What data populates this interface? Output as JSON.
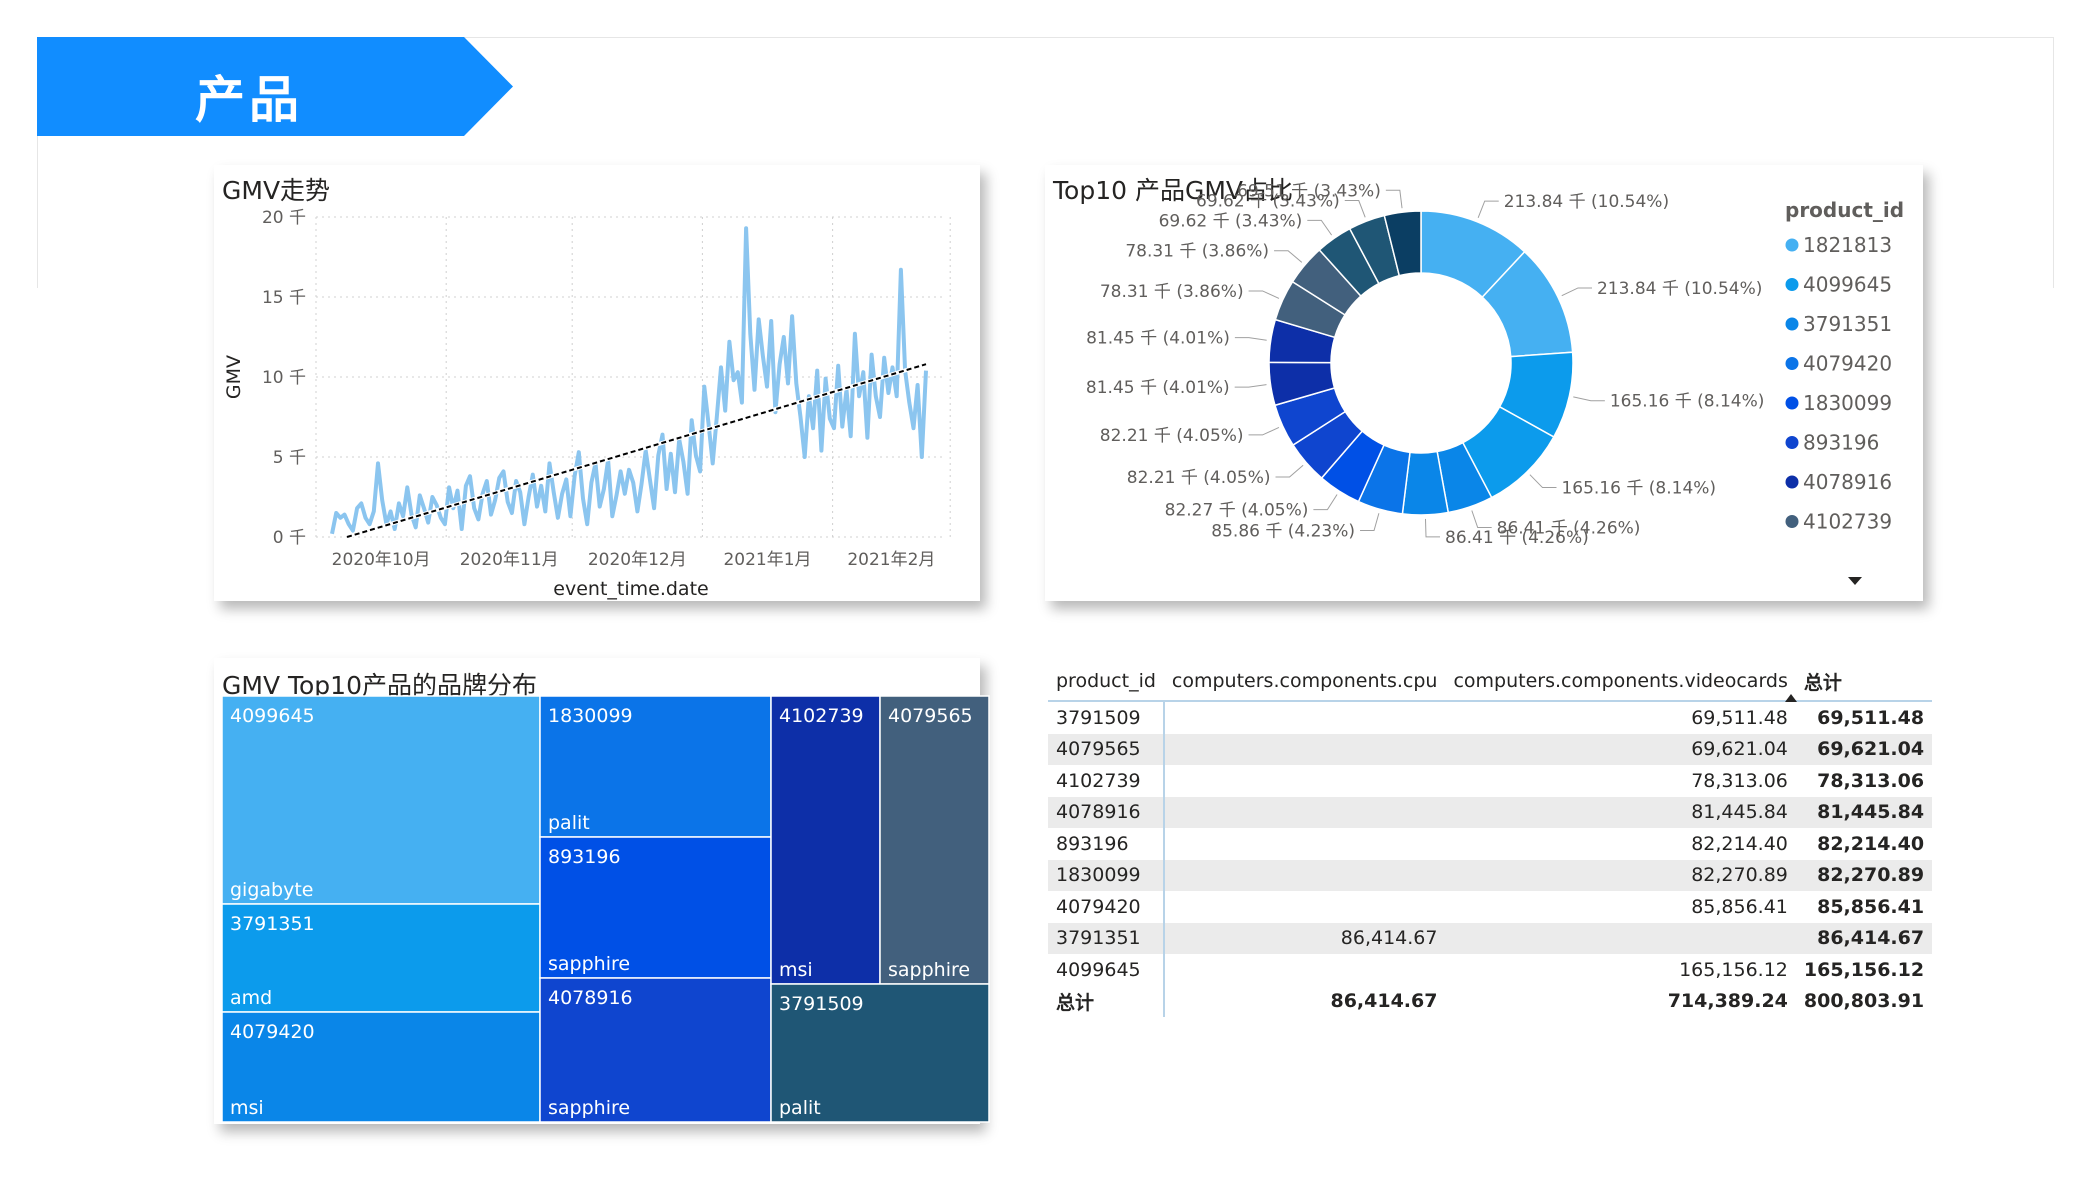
{
  "header": {
    "title": "产品",
    "color": "#118DFF"
  },
  "line_card": {
    "title": "GMV走势",
    "chart_data": {
      "type": "line",
      "title": "GMV走势",
      "xlabel": "event_time.date",
      "ylabel": "GMV",
      "y_ticks": [
        "0 千",
        "5 千",
        "10 千",
        "15 千",
        "20 千"
      ],
      "ylim": [
        0,
        20000
      ],
      "x_ticks": [
        "2020年10月",
        "2020年11月",
        "2020年12月",
        "2021年1月",
        "2021年2月"
      ],
      "x_range": [
        "2020-10-01",
        "2021-02-28"
      ],
      "series": [
        {
          "values": [
            200,
            1500,
            1200,
            1400,
            800,
            400,
            1800,
            2100,
            1200,
            800,
            1600,
            4600,
            2300,
            800,
            1600,
            500,
            2100,
            1300,
            3100,
            1400,
            600,
            2600,
            1800,
            900,
            2500,
            2000,
            1200,
            800,
            3100,
            1800,
            2900,
            500,
            3200,
            3800,
            1800,
            1100,
            2700,
            3500,
            1400,
            2300,
            3700,
            4100,
            2200,
            1500,
            3500,
            2800,
            800,
            2500,
            3900,
            1900,
            3200,
            1600,
            4600,
            2800,
            1200,
            2700,
            3600,
            1300,
            3800,
            5300,
            2400,
            800,
            3400,
            4600,
            1900,
            3000,
            4800,
            1300,
            2600,
            4100,
            2700,
            4200,
            3400,
            1600,
            3300,
            5400,
            3600,
            1800,
            5100,
            6400,
            3000,
            5200,
            2800,
            6100,
            4700,
            2700,
            7300,
            5100,
            4100,
            9400,
            7100,
            4600,
            7500,
            10600,
            7900,
            12200,
            9800,
            10300,
            8400,
            19300,
            12700,
            9200,
            13600,
            11300,
            9400,
            13500,
            7800,
            10800,
            12500,
            9600,
            13800,
            9600,
            7500,
            5000,
            8800,
            6800,
            10400,
            5400,
            9900,
            7400,
            6800,
            10700,
            6900,
            9200,
            6300,
            12700,
            8800,
            10300,
            6200,
            11400,
            8800,
            7500,
            11200,
            9000,
            10600,
            8800,
            16700,
            10400,
            8400,
            6800,
            9500,
            5000,
            10400
          ]
        }
      ],
      "trend": {
        "from": 0,
        "to": 10800,
        "style": "dashed",
        "color": "#000000"
      },
      "grid": true,
      "colors": {
        "series": "#8BC5EF"
      }
    }
  },
  "donut_card": {
    "title": "Top10 产品GMV占比",
    "chart_data": {
      "type": "pie",
      "title": "Top10 产品GMV占比",
      "legend_title": "product_id",
      "legend_position": "right",
      "legend_more_icon": "caret-down-icon",
      "labels": [
        "213.84 千 (10.54%)",
        "213.84 千 (10.54%)",
        "165.16 千 (8.14%)",
        "165.16 千 (8.14%)",
        "86.41 千 (4.26%)",
        "86.41 千 (4.26%)",
        "85.86 千 (4.23%)",
        "82.27 千 (4.05%)",
        "82.21 千 (4.05%)",
        "82.21 千 (4.05%)",
        "81.45 千 (4.01%)",
        "81.45 千 (4.01%)",
        "78.31 千 (3.86%)",
        "78.31 千 (3.86%)",
        "69.62 千 (3.43%)",
        "69.62 千 (3.43%)",
        "69.51 千 (3.43%)"
      ],
      "values": [
        213.84,
        213.84,
        165.16,
        165.16,
        86.41,
        86.41,
        85.86,
        82.27,
        82.21,
        82.21,
        81.45,
        81.45,
        78.31,
        78.31,
        69.62,
        69.62,
        69.51
      ],
      "slice_colors": [
        "#45B0F2",
        "#45B0F2",
        "#0C9BEC",
        "#0C9BEC",
        "#0A86E8",
        "#0A86E8",
        "#0B74E8",
        "#0050E6",
        "#0F45CF",
        "#0F45CF",
        "#0D2FA8",
        "#0D2FA8",
        "#42607D",
        "#42607D",
        "#1F5675",
        "#1F5675",
        "#0B3E63"
      ],
      "legend": [
        {
          "label": "1821813",
          "color": "#45B0F2"
        },
        {
          "label": "4099645",
          "color": "#0C9BEC"
        },
        {
          "label": "3791351",
          "color": "#0A86E8"
        },
        {
          "label": "4079420",
          "color": "#0B74E8"
        },
        {
          "label": "1830099",
          "color": "#0050E6"
        },
        {
          "label": "893196",
          "color": "#0F45CF"
        },
        {
          "label": "4078916",
          "color": "#0D2FA8"
        },
        {
          "label": "4102739",
          "color": "#42607D"
        }
      ]
    }
  },
  "treemap_card": {
    "title": "GMV Top10产品的品牌分布",
    "chart_data": {
      "type": "treemap",
      "title": "GMV Top10产品的品牌分布",
      "tiles": [
        {
          "id": "4099645",
          "brand": "gigabyte",
          "color": "#45B0F2"
        },
        {
          "id": "3791351",
          "brand": "amd",
          "color": "#0C9BEC"
        },
        {
          "id": "4079420",
          "brand": "msi",
          "color": "#0A86E8"
        },
        {
          "id": "1830099",
          "brand": "palit",
          "color": "#0B74E8"
        },
        {
          "id": "893196",
          "brand": "sapphire",
          "color": "#0050E6"
        },
        {
          "id": "4078916",
          "brand": "sapphire",
          "color": "#0F45CF"
        },
        {
          "id": "4102739",
          "brand": "msi",
          "color": "#0D2FA8"
        },
        {
          "id": "4079565",
          "brand": "sapphire",
          "color": "#42607D"
        },
        {
          "id": "3791509",
          "brand": "palit",
          "color": "#1F5675"
        }
      ]
    }
  },
  "matrix": {
    "columns": [
      "product_id",
      "computers.components.cpu",
      "computers.components.videocards",
      "总计"
    ],
    "rows": [
      {
        "id": "3791509",
        "cpu": "",
        "video": "69,511.48",
        "total": "69,511.48"
      },
      {
        "id": "4079565",
        "cpu": "",
        "video": "69,621.04",
        "total": "69,621.04"
      },
      {
        "id": "4102739",
        "cpu": "",
        "video": "78,313.06",
        "total": "78,313.06"
      },
      {
        "id": "4078916",
        "cpu": "",
        "video": "81,445.84",
        "total": "81,445.84"
      },
      {
        "id": "893196",
        "cpu": "",
        "video": "82,214.40",
        "total": "82,214.40"
      },
      {
        "id": "1830099",
        "cpu": "",
        "video": "82,270.89",
        "total": "82,270.89"
      },
      {
        "id": "4079420",
        "cpu": "",
        "video": "85,856.41",
        "total": "85,856.41"
      },
      {
        "id": "3791351",
        "cpu": "86,414.67",
        "video": "",
        "total": "86,414.67"
      },
      {
        "id": "4099645",
        "cpu": "",
        "video": "165,156.12",
        "total": "165,156.12"
      }
    ],
    "total": {
      "label": "总计",
      "cpu": "86,414.67",
      "video": "714,389.24",
      "total": "800,803.91"
    }
  }
}
